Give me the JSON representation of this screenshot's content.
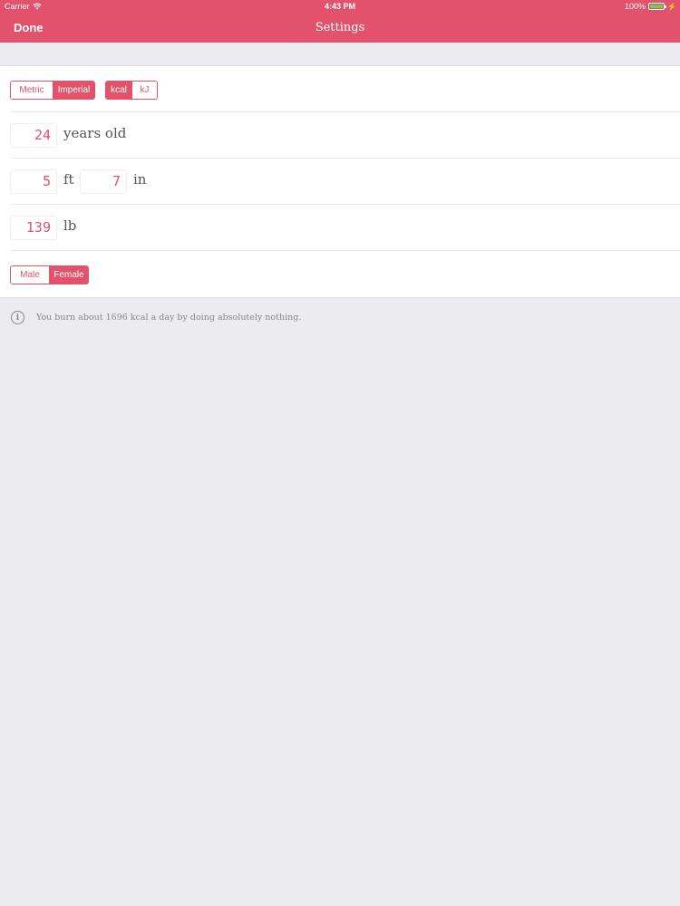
{
  "status_bar": {
    "carrier": "Carrier",
    "time": "4:43 PM",
    "battery": "100%",
    "battery_level": 1.0
  },
  "nav": {
    "done_label": "Done",
    "title": "Settings"
  },
  "units": {
    "system_options": [
      "Metric",
      "Imperial"
    ],
    "system_selected": "Imperial",
    "energy_options": [
      "kcal",
      "kJ"
    ],
    "energy_selected": "kcal"
  },
  "age": {
    "value": "24",
    "unit": "years old"
  },
  "height": {
    "feet": "5",
    "feet_unit": "ft",
    "inches": "7",
    "inches_unit": "in"
  },
  "weight": {
    "value": "139",
    "unit": "lb"
  },
  "sex": {
    "options": [
      "Male",
      "Female"
    ],
    "selected": "Female"
  },
  "info": {
    "icon": "info-icon",
    "text": "You burn about 1696 kcal a day by doing absolutely nothing."
  },
  "colors": {
    "accent": "#e2526a",
    "background": "#ebebf0"
  }
}
